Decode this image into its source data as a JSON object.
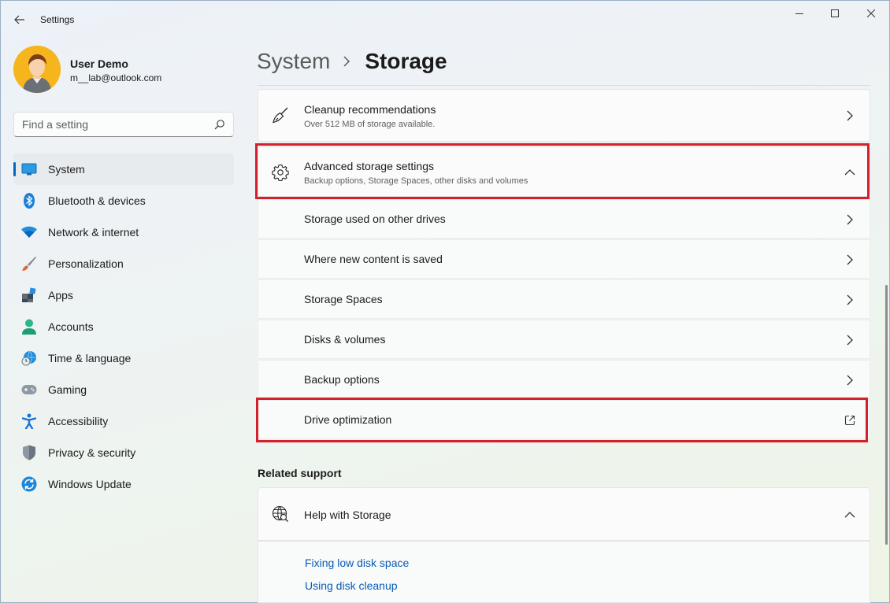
{
  "window": {
    "title": "Settings"
  },
  "profile": {
    "name": "User Demo",
    "email": "m__lab@outlook.com"
  },
  "search": {
    "placeholder": "Find a setting"
  },
  "nav": {
    "items": [
      {
        "label": "System",
        "icon": "monitor-icon"
      },
      {
        "label": "Bluetooth & devices",
        "icon": "bluetooth-icon"
      },
      {
        "label": "Network & internet",
        "icon": "wifi-icon"
      },
      {
        "label": "Personalization",
        "icon": "brush-icon"
      },
      {
        "label": "Apps",
        "icon": "apps-icon"
      },
      {
        "label": "Accounts",
        "icon": "account-icon"
      },
      {
        "label": "Time & language",
        "icon": "globe-clock-icon"
      },
      {
        "label": "Gaming",
        "icon": "gamepad-icon"
      },
      {
        "label": "Accessibility",
        "icon": "accessibility-icon"
      },
      {
        "label": "Privacy & security",
        "icon": "shield-icon"
      },
      {
        "label": "Windows Update",
        "icon": "update-icon"
      }
    ],
    "active": "System"
  },
  "header": {
    "parent": "System",
    "current": "Storage"
  },
  "cleanup": {
    "title": "Cleanup recommendations",
    "subtitle": "Over 512 MB of storage available."
  },
  "advanced": {
    "title": "Advanced storage settings",
    "subtitle": "Backup options, Storage Spaces, other disks and volumes"
  },
  "advanced_items": [
    {
      "label": "Storage used on other drives"
    },
    {
      "label": "Where new content is saved"
    },
    {
      "label": "Storage Spaces"
    },
    {
      "label": "Disks & volumes"
    },
    {
      "label": "Backup options"
    },
    {
      "label": "Drive optimization"
    }
  ],
  "related": {
    "title": "Related support",
    "help_title": "Help with Storage",
    "links": [
      "Fixing low disk space",
      "Using disk cleanup"
    ]
  },
  "colors": {
    "accent": "#0067c0",
    "highlight": "#d41f2d",
    "link": "#0a5bb8"
  }
}
